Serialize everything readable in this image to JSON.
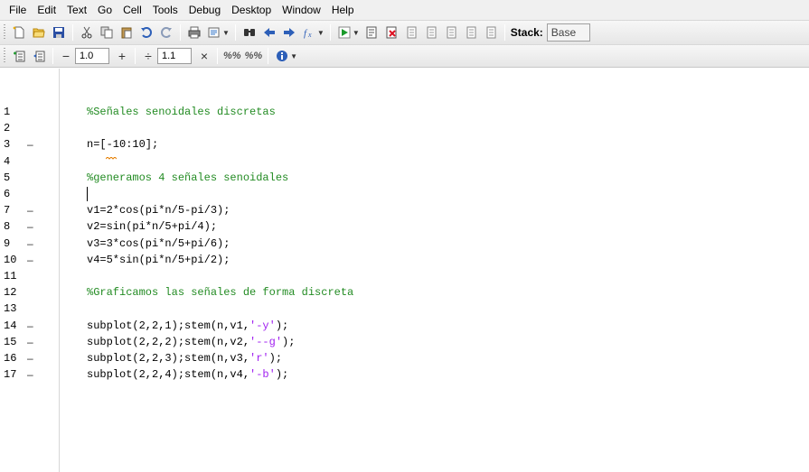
{
  "menubar": {
    "items": [
      "File",
      "Edit",
      "Text",
      "Go",
      "Cell",
      "Tools",
      "Debug",
      "Desktop",
      "Window",
      "Help"
    ]
  },
  "toolbar1": {
    "stack_label": "Stack:",
    "stack_value": "Base",
    "icons": [
      "new-file-icon",
      "open-folder-icon",
      "save-icon",
      "cut-icon",
      "copy-icon",
      "paste-icon",
      "undo-icon",
      "redo-icon",
      "print-icon",
      "comment-icon",
      "find-icon",
      "back-icon",
      "forward-icon",
      "fx-icon",
      "run-icon",
      "set-breakpoint-icon",
      "clear-breakpoint-icon",
      "step-icon",
      "step-in-icon",
      "step-out-icon",
      "continue-icon",
      "exit-debug-icon"
    ]
  },
  "toolbar2": {
    "minus_label": "−",
    "value1": "1.0",
    "plus_label": "+",
    "divide_label": "÷",
    "value2": "1.1",
    "times_label": "×",
    "pct1": "%%",
    "pct2": "%%"
  },
  "editor": {
    "lines": [
      {
        "num": "1",
        "mark": "",
        "parts": [
          {
            "t": "%Señales senoidales discretas",
            "c": "comment"
          }
        ]
      },
      {
        "num": "2",
        "mark": "",
        "parts": []
      },
      {
        "num": "3",
        "mark": "–",
        "parts": [
          {
            "t": "n=[-10:10];",
            "c": "code"
          }
        ]
      },
      {
        "num": "4",
        "mark": "",
        "parts": []
      },
      {
        "num": "5",
        "mark": "",
        "parts": [
          {
            "t": "%generamos 4 señales senoidales",
            "c": "comment"
          }
        ]
      },
      {
        "num": "6",
        "mark": "",
        "parts": []
      },
      {
        "num": "7",
        "mark": "–",
        "parts": [
          {
            "t": "v1=2*cos(pi*n/5-pi/3);",
            "c": "code"
          }
        ]
      },
      {
        "num": "8",
        "mark": "–",
        "parts": [
          {
            "t": "v2=sin(pi*n/5+pi/4);",
            "c": "code"
          }
        ]
      },
      {
        "num": "9",
        "mark": "–",
        "parts": [
          {
            "t": "v3=3*cos(pi*n/5+pi/6);",
            "c": "code"
          }
        ]
      },
      {
        "num": "10",
        "mark": "–",
        "parts": [
          {
            "t": "v4=5*sin(pi*n/5+pi/2);",
            "c": "code"
          }
        ]
      },
      {
        "num": "11",
        "mark": "",
        "parts": []
      },
      {
        "num": "12",
        "mark": "",
        "parts": [
          {
            "t": "%Graficamos las señales de forma discreta",
            "c": "comment"
          }
        ]
      },
      {
        "num": "13",
        "mark": "",
        "parts": []
      },
      {
        "num": "14",
        "mark": "–",
        "parts": [
          {
            "t": "subplot(2,2,1);stem(n,v1,",
            "c": "code"
          },
          {
            "t": "'-y'",
            "c": "str"
          },
          {
            "t": ");",
            "c": "code"
          }
        ]
      },
      {
        "num": "15",
        "mark": "–",
        "parts": [
          {
            "t": "subplot(2,2,2);stem(n,v2,",
            "c": "code"
          },
          {
            "t": "'--g'",
            "c": "str"
          },
          {
            "t": ");",
            "c": "code"
          }
        ]
      },
      {
        "num": "16",
        "mark": "–",
        "parts": [
          {
            "t": "subplot(2,2,3);stem(n,v3,",
            "c": "code"
          },
          {
            "t": "'r'",
            "c": "str"
          },
          {
            "t": ");",
            "c": "code"
          }
        ]
      },
      {
        "num": "17",
        "mark": "–",
        "parts": [
          {
            "t": "subplot(2,2,4);stem(n,v4,",
            "c": "code"
          },
          {
            "t": "'-b'",
            "c": "str"
          },
          {
            "t": ");",
            "c": "code"
          }
        ]
      }
    ],
    "colors": {
      "comment": "#228b22",
      "string": "#a020f0",
      "code": "#000000"
    }
  }
}
